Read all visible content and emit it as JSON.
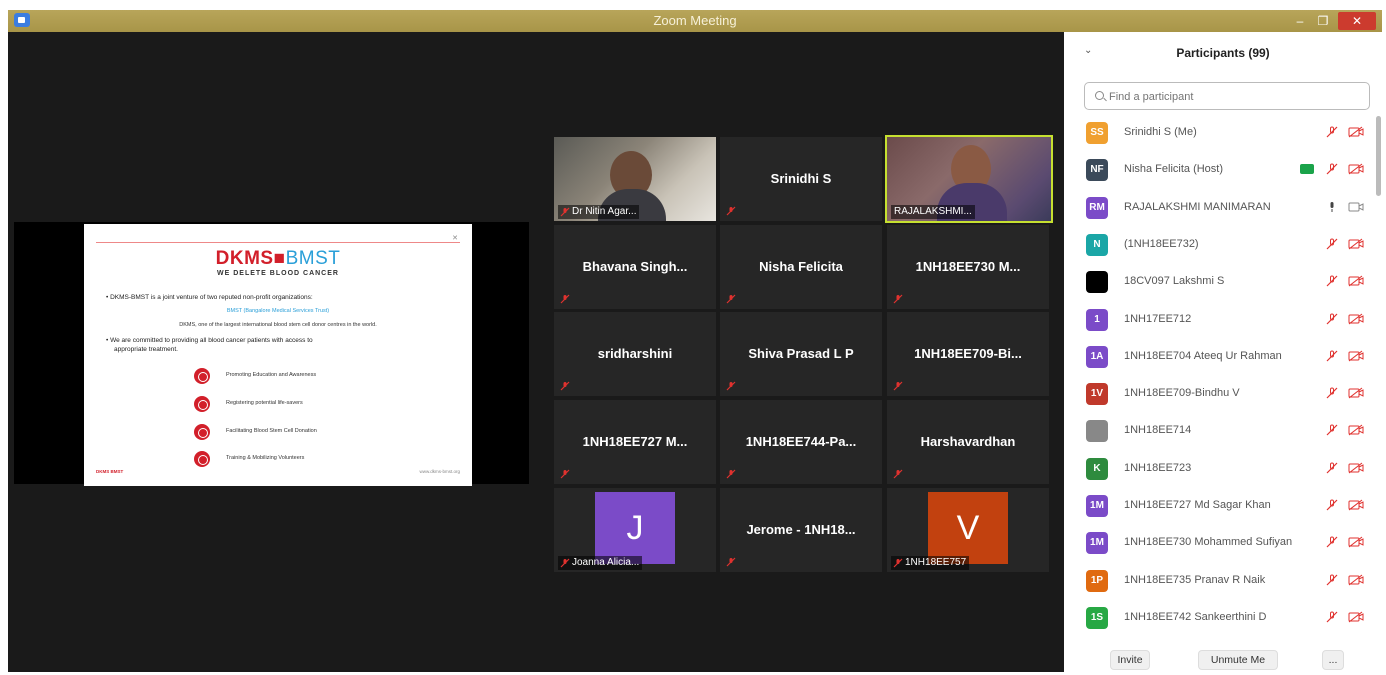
{
  "window": {
    "title": "Zoom Meeting",
    "min": "–",
    "max": "❐",
    "close": "✕"
  },
  "slide": {
    "logo_dkms": "DKMS",
    "logo_bmst": "BMST",
    "tagline": "WE DELETE BLOOD CANCER",
    "bullet1": "•  DKMS-BMST is a joint venture of two reputed non-profit organizations:",
    "sub1": "BMST (Bangalore Medical Services Trust)",
    "sub2": "DKMS, one of the largest international blood stem cell donor centres in the world.",
    "bullet2": "•  We are committed to providing all blood cancer patients with access to",
    "bullet2b": "appropriate treatment.",
    "items": [
      "Promoting Education and Awareness",
      "Registering potential life-savers",
      "Facilitating Blood Stem Cell Donation",
      "Training & Mobilizing Volunteers"
    ],
    "footer_left": "DKMS BMST",
    "footer_right": "www.dkms-bmst.org"
  },
  "gallery": {
    "tiles": [
      {
        "name": "",
        "label": "Dr Nitin Agar..."
      },
      {
        "name": "Srinidhi S",
        "label": ""
      },
      {
        "name": "",
        "label": "RAJALAKSHMI..."
      },
      {
        "name": "Bhavana  Singh...",
        "label": ""
      },
      {
        "name": "Nisha Felicita",
        "label": ""
      },
      {
        "name": "1NH18EE730  M...",
        "label": ""
      },
      {
        "name": "sridharshini",
        "label": ""
      },
      {
        "name": "Shiva Prasad L P",
        "label": ""
      },
      {
        "name": "1NH18EE709-Bi...",
        "label": ""
      },
      {
        "name": "1NH18EE727  M...",
        "label": ""
      },
      {
        "name": "1NH18EE744-Pa...",
        "label": ""
      },
      {
        "name": "Harshavardhan",
        "label": ""
      },
      {
        "name": "",
        "label": "Joanna Alicia...",
        "initial": "J"
      },
      {
        "name": "Jerome  -  1NH18...",
        "label": ""
      },
      {
        "name": "",
        "label": "1NH18EE757",
        "initial": "V"
      }
    ]
  },
  "participants": {
    "title": "Participants (99)",
    "search_placeholder": "Find a participant",
    "list": [
      {
        "initials": "SS",
        "name": "Srinidhi S (Me)",
        "color": "#f0a030"
      },
      {
        "initials": "NF",
        "name": "Nisha Felicita (Host)",
        "color": "#3b4a5a"
      },
      {
        "initials": "RM",
        "name": "RAJALAKSHMI MANIMARAN",
        "color": "#7b4bc8"
      },
      {
        "initials": "N",
        "name": "(1NH18EE732)",
        "color": "#1aa6a6"
      },
      {
        "initials": "",
        "name": "18CV097 Lakshmi S",
        "color": "#000000"
      },
      {
        "initials": "1",
        "name": "1NH17EE712",
        "color": "#7b4bc8"
      },
      {
        "initials": "1A",
        "name": "1NH18EE704 Ateeq Ur Rahman",
        "color": "#7b4bc8"
      },
      {
        "initials": "1V",
        "name": "1NH18EE709-Bindhu V",
        "color": "#c0392b"
      },
      {
        "initials": "",
        "name": "1NH18EE714",
        "color": "#888888"
      },
      {
        "initials": "K",
        "name": "1NH18EE723",
        "color": "#2e8b3e"
      },
      {
        "initials": "1M",
        "name": "1NH18EE727 Md Sagar Khan",
        "color": "#7b4bc8"
      },
      {
        "initials": "1M",
        "name": "1NH18EE730 Mohammed Sufiyan",
        "color": "#7b4bc8"
      },
      {
        "initials": "1P",
        "name": "1NH18EE735 Pranav R Naik",
        "color": "#e06a10"
      },
      {
        "initials": "1S",
        "name": "1NH18EE742 Sankeerthini D",
        "color": "#27a844"
      }
    ],
    "invite": "Invite",
    "unmute": "Unmute Me",
    "more": "..."
  },
  "colors": {
    "accent_muted": "#e0322f",
    "tile_bg": "#262626",
    "active_speaker": "#c6e030"
  }
}
